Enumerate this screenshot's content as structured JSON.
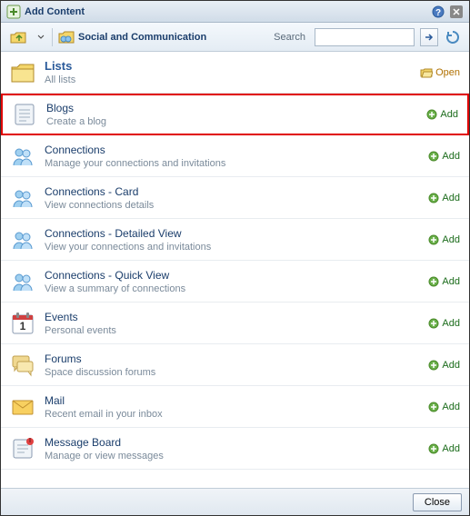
{
  "dialog": {
    "title": "Add Content"
  },
  "toolbar": {
    "breadcrumb": "Social and Communication",
    "search_label": "Search"
  },
  "actions": {
    "open_label": "Open",
    "add_label": "Add",
    "close_label": "Close"
  },
  "items": [
    {
      "title": "Lists",
      "desc": "All lists",
      "action": "open",
      "icon": "folder",
      "highlight": false,
      "lists": true
    },
    {
      "title": "Blogs",
      "desc": "Create a blog",
      "action": "add",
      "icon": "doc",
      "highlight": true
    },
    {
      "title": "Connections",
      "desc": "Manage your connections and invitations",
      "action": "add",
      "icon": "people"
    },
    {
      "title": "Connections - Card",
      "desc": "View connections details",
      "action": "add",
      "icon": "people"
    },
    {
      "title": "Connections - Detailed View",
      "desc": "View your connections and invitations",
      "action": "add",
      "icon": "people"
    },
    {
      "title": "Connections - Quick View",
      "desc": "View a summary of connections",
      "action": "add",
      "icon": "people"
    },
    {
      "title": "Events",
      "desc": "Personal events",
      "action": "add",
      "icon": "calendar"
    },
    {
      "title": "Forums",
      "desc": "Space discussion forums",
      "action": "add",
      "icon": "forum"
    },
    {
      "title": "Mail",
      "desc": "Recent email in your inbox",
      "action": "add",
      "icon": "mail"
    },
    {
      "title": "Message Board",
      "desc": "Manage or view messages",
      "action": "add",
      "icon": "board"
    }
  ]
}
